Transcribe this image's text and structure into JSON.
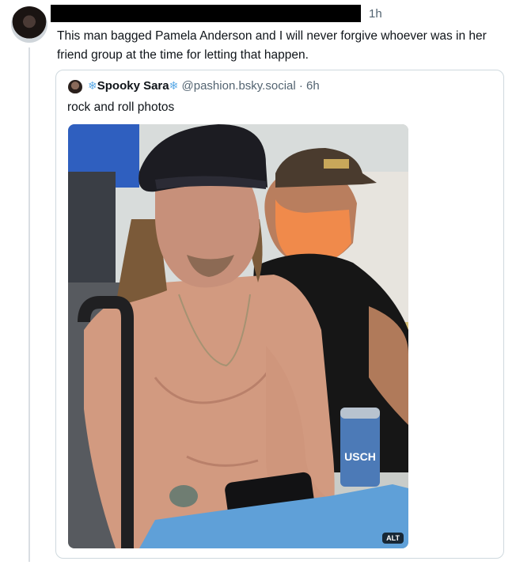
{
  "post": {
    "time": "1h",
    "text": "This man bagged Pamela Anderson and I will never forgive whoever was in her friend group at the time for letting that happen."
  },
  "quote": {
    "snow_left": "❄",
    "display_name": "Spooky Sara",
    "snow_right": "❄",
    "handle_time": "@pashion.bsky.social · 6h",
    "text": "rock and roll photos",
    "image": {
      "alt_badge": "ALT",
      "can_text": "USCH"
    }
  },
  "colors": {
    "accent": "#5aa9e6",
    "muted": "#536471",
    "border": "#cfd9de"
  }
}
